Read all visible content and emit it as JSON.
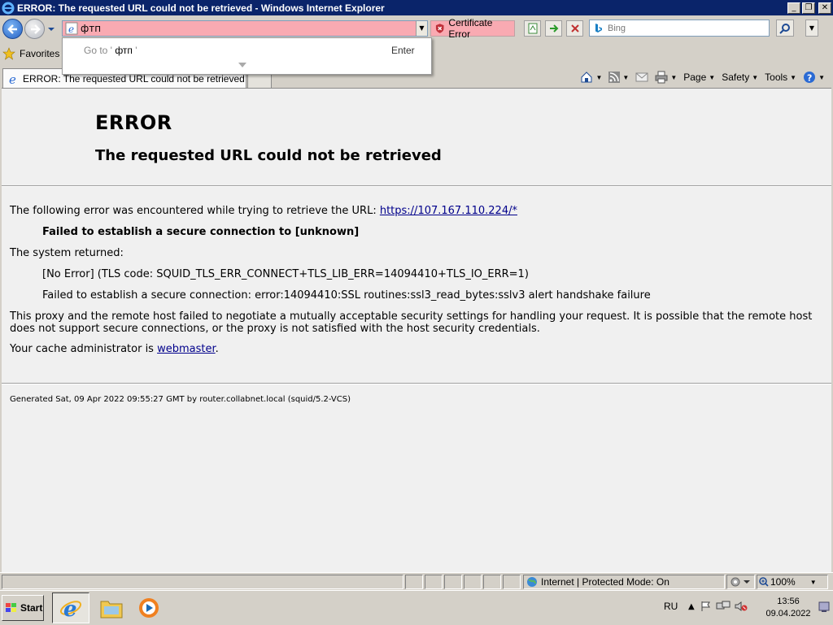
{
  "window": {
    "title": "ERROR: The requested URL could not be retrieved - Windows Internet Explorer"
  },
  "navbar": {
    "address_value": "фтп",
    "cert_error_label": "Certificate Error",
    "search_placeholder": "Bing"
  },
  "autocomplete": {
    "goto_prefix": "Go to '",
    "goto_query": " фтп",
    "goto_suffix": " '",
    "enter_label": "Enter"
  },
  "favorites": {
    "label": "Favorites"
  },
  "tab": {
    "title": "ERROR: The requested URL could not be retrieved"
  },
  "cmdbar": {
    "page": "Page",
    "safety": "Safety",
    "tools": "Tools"
  },
  "content": {
    "heading": "ERROR",
    "subheading": "The requested URL could not be retrieved",
    "intro": "The following error was encountered while trying to retrieve the URL: ",
    "url": "https://107.167.110.224/*",
    "fail_connect": "Failed to establish a secure connection to [unknown]",
    "system_returned": "The system returned:",
    "tls_code": "[No Error] (TLS code: SQUID_TLS_ERR_CONNECT+TLS_LIB_ERR=14094410+TLS_IO_ERR=1)",
    "ssl_error": "Failed to establish a secure connection: error:14094410:SSL routines:ssl3_read_bytes:sslv3 alert handshake failure",
    "description": "This proxy and the remote host failed to negotiate a mutually acceptable security settings for handling your request. It is possible that the remote host does not support secure connections, or the proxy is not satisfied with the host security credentials.",
    "admin_prefix": "Your cache administrator is ",
    "admin_link": "webmaster",
    "admin_suffix": ".",
    "generated": "Generated Sat, 09 Apr 2022 09:55:27 GMT by router.collabnet.local (squid/5.2-VCS)"
  },
  "statusbar": {
    "zone": "Internet | Protected Mode: On",
    "zoom": "100%"
  },
  "taskbar": {
    "start": "Start",
    "lang": "RU",
    "time": "13:56",
    "date": "09.04.2022"
  },
  "colors": {
    "titlebar": "#0a246a",
    "address_error_bg": "#f9aab2",
    "link": "#00008b",
    "content_bg": "#f0f0f0"
  }
}
